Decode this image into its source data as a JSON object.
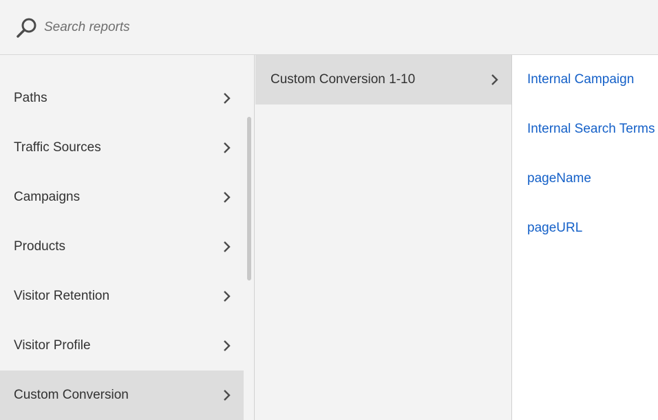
{
  "search": {
    "placeholder": "Search reports",
    "icon": "search-icon"
  },
  "column1": {
    "items": [
      {
        "label": "Paths",
        "selected": false
      },
      {
        "label": "Traffic Sources",
        "selected": false
      },
      {
        "label": "Campaigns",
        "selected": false
      },
      {
        "label": "Products",
        "selected": false
      },
      {
        "label": "Visitor Retention",
        "selected": false
      },
      {
        "label": "Visitor Profile",
        "selected": false
      },
      {
        "label": "Custom Conversion",
        "selected": true
      }
    ]
  },
  "column2": {
    "items": [
      {
        "label": "Custom Conversion 1-10",
        "selected": true
      }
    ]
  },
  "column3": {
    "links": [
      {
        "label": "Internal Campaign"
      },
      {
        "label": "Internal Search Terms"
      },
      {
        "label": "pageName"
      },
      {
        "label": "pageURL"
      }
    ]
  },
  "colors": {
    "link": "#1460c8",
    "selected_bg": "#dddddd",
    "panel_bg": "#f3f3f3"
  }
}
